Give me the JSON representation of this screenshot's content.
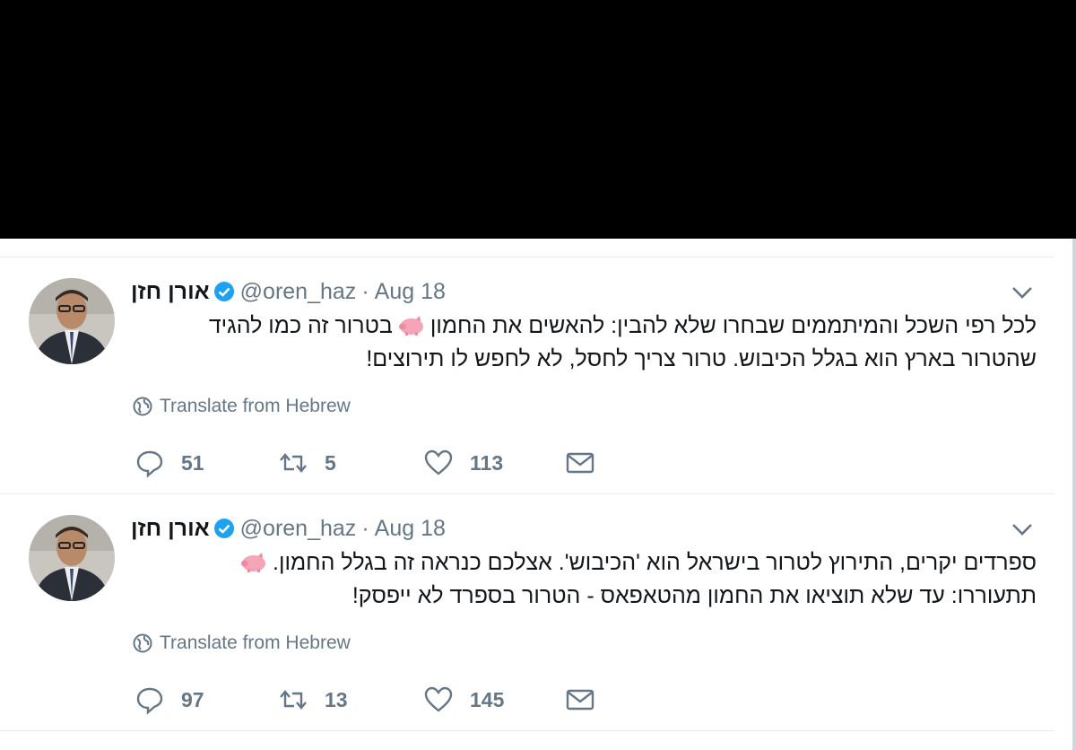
{
  "tweets": [
    {
      "name": "אורן חזן",
      "handle": "@oren_haz",
      "separator": "·",
      "date": "Aug 18",
      "text_a": "לכל רפי השכל והמיתממים שבחרו שלא להבין: להאשים את החמון",
      "text_b": "בטרור זה כמו להגיד שהטרור בארץ הוא בגלל הכיבוש. טרור צריך לחסל, לא לחפש לו תירוצים!",
      "translate": "Translate from Hebrew",
      "replies": "51",
      "retweets": "5",
      "likes": "113",
      "icons": [
        "verified-badge-icon",
        "pig-emoji-icon",
        "chevron-down-icon",
        "globe-icon",
        "reply-icon",
        "retweet-icon",
        "heart-icon",
        "mail-icon"
      ]
    },
    {
      "name": "אורן חזן",
      "handle": "@oren_haz",
      "separator": "·",
      "date": "Aug 18",
      "text_a": "ספרדים יקרים, התירוץ לטרור בישראל הוא 'הכיבוש'. אצלכם כנראה זה בגלל החמון.",
      "text_b": "תתעוררו: עד שלא תוציאו את החמון מהטאפאס - הטרור בספרד לא ייפסק!",
      "translate": "Translate from Hebrew",
      "replies": "97",
      "retweets": "13",
      "likes": "145",
      "icons": [
        "verified-badge-icon",
        "pig-emoji-icon",
        "chevron-down-icon",
        "globe-icon",
        "reply-icon",
        "retweet-icon",
        "heart-icon",
        "mail-icon"
      ]
    }
  ],
  "colors": {
    "text": "#14171a",
    "muted": "#657786",
    "verified": "#1da1f2",
    "pig": "#f4a6b8",
    "band": "#000000"
  }
}
